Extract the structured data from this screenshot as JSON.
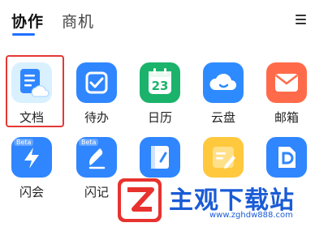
{
  "tabs": [
    {
      "label": "协作",
      "active": true
    },
    {
      "label": "商机",
      "active": false
    }
  ],
  "menu_icon": "hamburger-menu-icon",
  "apps_row1": [
    {
      "label": "文档",
      "icon": "document-icon",
      "color": "#d9f0ff",
      "selected": true
    },
    {
      "label": "待办",
      "icon": "todo-check-icon",
      "color": "#2f86ff"
    },
    {
      "label": "日历",
      "icon": "calendar-icon",
      "date": "23",
      "color": "#1bb36b"
    },
    {
      "label": "云盘",
      "icon": "cloud-drive-icon",
      "color": "#2e8bff"
    },
    {
      "label": "邮箱",
      "icon": "mail-icon",
      "color": "#ff6b4a"
    }
  ],
  "apps_row2": [
    {
      "label": "闪会",
      "icon": "flash-meeting-icon",
      "badge": "Beta",
      "color": "#2f86ff"
    },
    {
      "label": "闪记",
      "icon": "flash-note-icon",
      "badge": "Beta",
      "color": "#2f86ff"
    },
    {
      "icon": "notebook-icon",
      "color": "#2f86ff"
    },
    {
      "icon": "note-pencil-icon",
      "color": "#ffc83d"
    },
    {
      "icon": "cloud-doc-icon",
      "color": "#2f86ff"
    }
  ],
  "watermark": {
    "title": "主观下载站",
    "url": "www.zghdw888.com"
  }
}
